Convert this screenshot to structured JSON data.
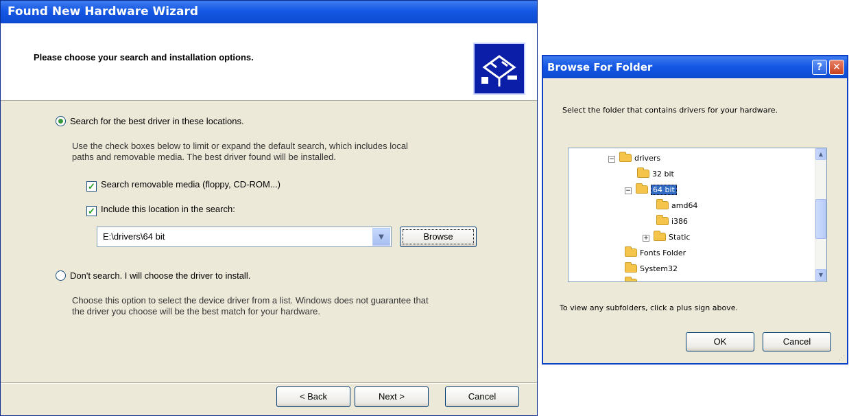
{
  "wizard": {
    "title": "Found New Hardware Wizard",
    "heading": "Please choose your search and installation options.",
    "option_search": {
      "label": "Search for the best driver in these locations.",
      "selected": true,
      "description_line1": "Use the check boxes below to limit or expand the default search, which includes local",
      "description_line2": "paths and removable media. The best driver found will be installed."
    },
    "check_removable": {
      "label": "Search removable media (floppy, CD-ROM...)",
      "checked": true
    },
    "check_location": {
      "label": "Include this location in the search:",
      "checked": true
    },
    "location_value": "E:\\drivers\\64 bit",
    "browse_label": "Browse",
    "option_dont_search": {
      "label": "Don't search. I will choose the driver to install.",
      "selected": false,
      "description_line1": "Choose this option to select the device driver from a list.  Windows does not guarantee that",
      "description_line2": "the driver you choose will be the best match for your hardware."
    },
    "buttons": {
      "back": "< Back",
      "next": "Next >",
      "cancel": "Cancel"
    }
  },
  "browse_dialog": {
    "title": "Browse For Folder",
    "help_glyph": "?",
    "close_glyph": "✕",
    "instruction": "Select the folder that contains drivers for your hardware.",
    "tree": [
      {
        "label": "drivers",
        "expander": "⊟"
      },
      {
        "label": "32 bit",
        "expander": ""
      },
      {
        "label": "64 bit",
        "expander": "⊟",
        "selected": true
      },
      {
        "label": "amd64",
        "expander": ""
      },
      {
        "label": "i386",
        "expander": ""
      },
      {
        "label": "Static",
        "expander": "⊞"
      },
      {
        "label": "Fonts Folder",
        "expander": ""
      },
      {
        "label": "System32",
        "expander": ""
      }
    ],
    "hint": "To view any subfolders, click a plus sign above.",
    "ok_label": "OK",
    "cancel_label": "Cancel"
  },
  "colors": {
    "titlebar_blue": "#1558e4",
    "dialog_face": "#ece9d8",
    "selection": "#316ac5"
  }
}
